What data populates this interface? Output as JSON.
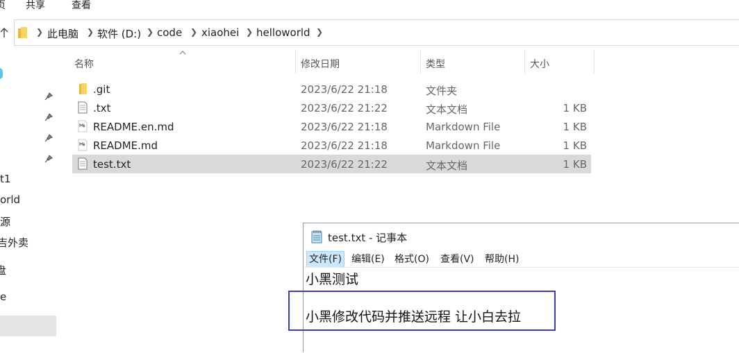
{
  "ribbon": {
    "tabs": [
      "页",
      "共享",
      "查看"
    ]
  },
  "address_bar": {
    "crumbs": [
      "此电脑",
      "软件 (D:)",
      "code",
      "xiaohei",
      "helloworld"
    ]
  },
  "nav_pane": {
    "items": [
      "t1",
      "orld",
      "源",
      "吉外卖",
      "盘",
      "e"
    ]
  },
  "file_list": {
    "columns": {
      "name": "名称",
      "date": "修改日期",
      "type": "类型",
      "size": "大小"
    },
    "rows": [
      {
        "name": ".git",
        "date": "2023/6/22 21:18",
        "type": "文件夹",
        "size": "",
        "icon": "folder-icon"
      },
      {
        "name": ".txt",
        "date": "2023/6/22 21:22",
        "type": "文本文档",
        "size": "1 KB",
        "icon": "text-file-icon"
      },
      {
        "name": "README.en.md",
        "date": "2023/6/22 21:18",
        "type": "Markdown File",
        "size": "1 KB",
        "icon": "markdown-file-icon"
      },
      {
        "name": "README.md",
        "date": "2023/6/22 21:18",
        "type": "Markdown File",
        "size": "1 KB",
        "icon": "markdown-file-icon"
      },
      {
        "name": "test.txt",
        "date": "2023/6/22 21:22",
        "type": "文本文档",
        "size": "1 KB",
        "icon": "text-file-icon",
        "selected": true
      }
    ]
  },
  "notepad": {
    "title": "test.txt - 记事本",
    "menu": [
      "文件(F)",
      "编辑(E)",
      "格式(O)",
      "查看(V)",
      "帮助(H)"
    ],
    "lines": [
      "小黑测试",
      "",
      "小黑修改代码并推送远程  让小白去拉"
    ]
  },
  "colors": {
    "annotation_box": "#3c3cb4",
    "selection": "#d9d9d9",
    "menu_active": "#cce8ff"
  }
}
